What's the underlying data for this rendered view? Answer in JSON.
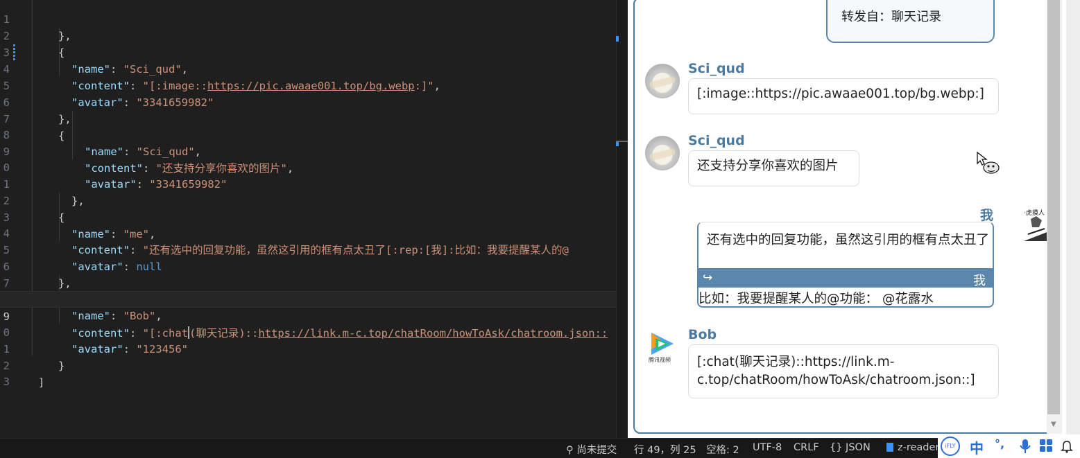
{
  "editor": {
    "lines": [
      {
        "no": "1",
        "text": "},"
      },
      {
        "no": "2",
        "text": "{"
      },
      {
        "no": "3",
        "key": "\"name\"",
        "value": "\"Sci_qud\"",
        "tail": ","
      },
      {
        "no": "4",
        "key": "\"content\"",
        "value_prefix": "\"[:image::",
        "value_link": "https://pic.awaae001.top/bg.webp",
        "value_suffix": ":]\"",
        "tail": ","
      },
      {
        "no": "5",
        "key": "\"avatar\"",
        "value": "\"3341659982\""
      },
      {
        "no": "6",
        "text": "},"
      },
      {
        "no": "7",
        "text": "{"
      },
      {
        "no": "8",
        "key": "\"name\"",
        "value": "\"Sci_qud\"",
        "tail": ","
      },
      {
        "no": "9",
        "key": "\"content\"",
        "value": "\"还支持分享你喜欢的图片\"",
        "tail": ","
      },
      {
        "no": "0",
        "key": "\"avatar\"",
        "value": "\"3341659982\""
      },
      {
        "no": "1",
        "text": "},"
      },
      {
        "no": "2",
        "text": "{"
      },
      {
        "no": "3",
        "key": "\"name\"",
        "value": "\"me\"",
        "tail": ","
      },
      {
        "no": "4",
        "key": "\"content\"",
        "value": "\"还有选中的回复功能，虽然这引用的框有点太丑了[:rep:[我]:比如：我要提醒某人的@"
      },
      {
        "no": "5",
        "key": "\"avatar\"",
        "value_null": "null"
      },
      {
        "no": "6",
        "text": "},"
      },
      {
        "no": "7",
        "text": "{"
      },
      {
        "no": "8",
        "key": "\"name\"",
        "value": "\"Bob\"",
        "tail": ","
      },
      {
        "no": "9",
        "key": "\"content\"",
        "value_prefix": "\"[:chat",
        "value_after_cursor": "(聊天记录)::",
        "value_link": "https://link.m-c.top/chatRoom/howToAsk/chatroom.json::"
      },
      {
        "no": "0",
        "key": "\"avatar\"",
        "value": "\"123456\""
      },
      {
        "no": "1",
        "text": "}"
      },
      {
        "no": "2",
        "text": "]"
      },
      {
        "no": "3",
        "text": ""
      }
    ]
  },
  "preview": {
    "forward_text": "转发自：聊天记录",
    "messages": [
      {
        "name": "Sci_qud",
        "text": "[:image::https://pic.awaae001.top/bg.webp:]"
      },
      {
        "name": "Sci_qud",
        "text": "还支持分享你喜欢的图片"
      },
      {
        "name": "我",
        "text": "还有选中的回复功能，虽然这引用的框有点太丑了",
        "quote_from": "我",
        "quote_text": "比如：我要提醒某人的@功能： @花露水"
      },
      {
        "name": "Bob",
        "text_line1": "[:chat(聊天记录)::https://link.m-",
        "text_line2": "c.top/chatRoom/howToAsk/chatroom.json::]"
      }
    ]
  },
  "statusbar": {
    "git": "尚未提交",
    "position": "行 49，列 25",
    "spaces": "空格: 2",
    "encoding": "UTF-8",
    "eol": "CRLF",
    "language": "{} JSON",
    "extension": "z-reader"
  },
  "ime": {
    "brand": "iFLY",
    "lang": "中",
    "punct": "°,",
    "mic": "mic-icon",
    "apps": "apps-icon"
  },
  "colors": {
    "accent": "#5a87ab",
    "name": "#4a7aa0",
    "editor_bg": "#1f1f1f",
    "json_key": "#9cdcfe",
    "json_string": "#ce9178"
  }
}
